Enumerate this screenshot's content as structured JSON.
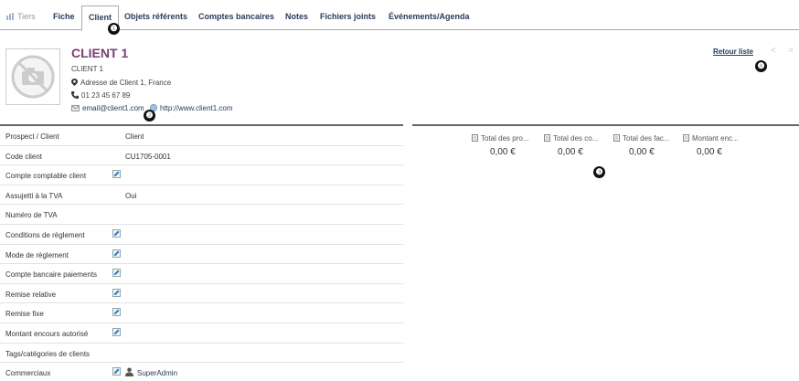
{
  "tabs": [
    {
      "label": "Tiers"
    },
    {
      "label": "Fiche"
    },
    {
      "label": "Client"
    },
    {
      "label": "Objets référents"
    },
    {
      "label": "Comptes bancaires"
    },
    {
      "label": "Notes"
    },
    {
      "label": "Fichiers joints"
    },
    {
      "label": "Événements/Agenda"
    }
  ],
  "callouts": [
    "❶",
    "❷",
    "❸",
    "❹"
  ],
  "header": {
    "name": "CLIENT 1",
    "subname": "CLIENT 1",
    "address": "Adresse de Client 1, France",
    "phone": "01 23 45 67 89",
    "email": "email@client1.com",
    "website": "http://www.client1.com",
    "back_label": "Retour liste",
    "prev": "<",
    "next": ">"
  },
  "fields": [
    {
      "label": "Prospect / Client",
      "value": "Client",
      "editable": false
    },
    {
      "label": "Code client",
      "value": "CU1705-0001",
      "editable": false
    },
    {
      "label": "Compte comptable client",
      "value": "",
      "editable": true
    },
    {
      "label": "Assujetti à la TVA",
      "value": "Oui",
      "editable": false
    },
    {
      "label": "Numéro de TVA",
      "value": "",
      "editable": false
    },
    {
      "label": "Conditions de règlement",
      "value": "",
      "editable": true
    },
    {
      "label": "Mode de règlement",
      "value": "",
      "editable": true
    },
    {
      "label": "Compte bancaire paiements",
      "value": "",
      "editable": true
    },
    {
      "label": "Remise relative",
      "value": "",
      "editable": true
    },
    {
      "label": "Remise fixe",
      "value": "",
      "editable": true
    },
    {
      "label": "Montant encours autorisé",
      "value": "",
      "editable": true
    },
    {
      "label": "Tags/catégories de clients",
      "value": "",
      "editable": false
    },
    {
      "label": "Commerciaux",
      "value": "SuperAdmin",
      "editable": true
    }
  ],
  "stats": [
    {
      "title": "Total des pro...",
      "value": "0,00 €"
    },
    {
      "title": "Total des co...",
      "value": "0,00 €"
    },
    {
      "title": "Total des fac...",
      "value": "0,00 €"
    },
    {
      "title": "Montant enc...",
      "value": "0,00 €"
    }
  ],
  "colors": {
    "accent": "#263c5c",
    "name": "#7a3c74"
  }
}
